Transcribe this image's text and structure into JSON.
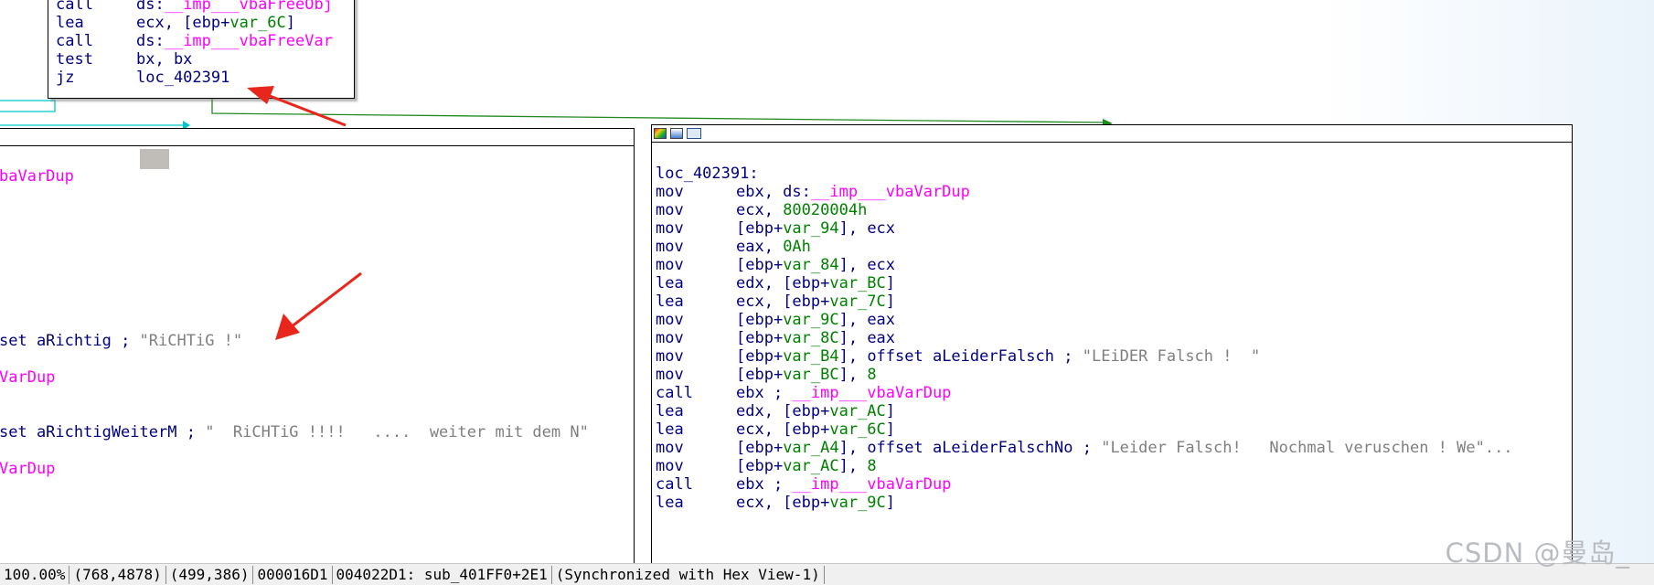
{
  "top_block": {
    "lines": [
      {
        "mnemonic": "call",
        "tokens": [
          {
            "t": "ds:",
            "c": "reg"
          },
          {
            "t": "__imp___vbaFreeObj",
            "c": "imp"
          }
        ]
      },
      {
        "mnemonic": "lea",
        "tokens": [
          {
            "t": "ecx, [ebp+",
            "c": "reg"
          },
          {
            "t": "var_6C",
            "c": "var"
          },
          {
            "t": "]",
            "c": "reg"
          }
        ]
      },
      {
        "mnemonic": "call",
        "tokens": [
          {
            "t": "ds:",
            "c": "reg"
          },
          {
            "t": "__imp___vbaFreeVar",
            "c": "imp"
          }
        ]
      },
      {
        "mnemonic": "test",
        "tokens": [
          {
            "t": "bx, bx",
            "c": "reg"
          }
        ]
      },
      {
        "mnemonic": "jz",
        "tokens": [
          {
            "t": "loc_402391",
            "c": "reg"
          }
        ]
      }
    ]
  },
  "left_block": {
    "lines": [
      {
        "row": 1,
        "tokens": [
          {
            "t": "baVarDup",
            "c": "imp"
          }
        ]
      },
      {
        "row": 10,
        "tokens": [
          {
            "t": "set aRichtig",
            "c": "reg"
          },
          {
            "t": " ; ",
            "c": "reg"
          },
          {
            "t": "\"RiCHTiG !\"",
            "c": "cmt"
          }
        ]
      },
      {
        "row": 12,
        "tokens": [
          {
            "t": "VarDup",
            "c": "imp"
          }
        ]
      },
      {
        "row": 15,
        "tokens": [
          {
            "t": "set aRichtigWeiterM",
            "c": "reg"
          },
          {
            "t": " ; ",
            "c": "reg"
          },
          {
            "t": "\"  RiCHTiG !!!!   ....  weiter mit dem N\"",
            "c": "cmt"
          }
        ]
      },
      {
        "row": 17,
        "tokens": [
          {
            "t": "VarDup",
            "c": "imp"
          }
        ]
      }
    ]
  },
  "right_block": {
    "label": "loc_402391:",
    "lines": [
      {
        "mnemonic": "mov",
        "tokens": [
          {
            "t": "ebx, ds:",
            "c": "reg"
          },
          {
            "t": "__imp___vbaVarDup",
            "c": "imp"
          }
        ]
      },
      {
        "mnemonic": "mov",
        "tokens": [
          {
            "t": "ecx, ",
            "c": "reg"
          },
          {
            "t": "80020004h",
            "c": "num"
          }
        ]
      },
      {
        "mnemonic": "mov",
        "tokens": [
          {
            "t": "[ebp+",
            "c": "reg"
          },
          {
            "t": "var_94",
            "c": "var"
          },
          {
            "t": "], ecx",
            "c": "reg"
          }
        ]
      },
      {
        "mnemonic": "mov",
        "tokens": [
          {
            "t": "eax, ",
            "c": "reg"
          },
          {
            "t": "0Ah",
            "c": "num"
          }
        ]
      },
      {
        "mnemonic": "mov",
        "tokens": [
          {
            "t": "[ebp+",
            "c": "reg"
          },
          {
            "t": "var_84",
            "c": "var"
          },
          {
            "t": "], ecx",
            "c": "reg"
          }
        ]
      },
      {
        "mnemonic": "lea",
        "tokens": [
          {
            "t": "edx, [ebp+",
            "c": "reg"
          },
          {
            "t": "var_BC",
            "c": "var"
          },
          {
            "t": "]",
            "c": "reg"
          }
        ]
      },
      {
        "mnemonic": "lea",
        "tokens": [
          {
            "t": "ecx, [ebp+",
            "c": "reg"
          },
          {
            "t": "var_7C",
            "c": "var"
          },
          {
            "t": "]",
            "c": "reg"
          }
        ]
      },
      {
        "mnemonic": "mov",
        "tokens": [
          {
            "t": "[ebp+",
            "c": "reg"
          },
          {
            "t": "var_9C",
            "c": "var"
          },
          {
            "t": "], eax",
            "c": "reg"
          }
        ]
      },
      {
        "mnemonic": "mov",
        "tokens": [
          {
            "t": "[ebp+",
            "c": "reg"
          },
          {
            "t": "var_8C",
            "c": "var"
          },
          {
            "t": "], eax",
            "c": "reg"
          }
        ]
      },
      {
        "mnemonic": "mov",
        "tokens": [
          {
            "t": "[ebp+",
            "c": "reg"
          },
          {
            "t": "var_B4",
            "c": "var"
          },
          {
            "t": "], offset aLeiderFalsch",
            "c": "reg"
          },
          {
            "t": " ; ",
            "c": "reg"
          },
          {
            "t": "\"LEiDER Falsch !  \"",
            "c": "cmt"
          }
        ]
      },
      {
        "mnemonic": "mov",
        "tokens": [
          {
            "t": "[ebp+",
            "c": "reg"
          },
          {
            "t": "var_BC",
            "c": "var"
          },
          {
            "t": "], ",
            "c": "reg"
          },
          {
            "t": "8",
            "c": "num"
          }
        ]
      },
      {
        "mnemonic": "call",
        "tokens": [
          {
            "t": "ebx ; ",
            "c": "reg"
          },
          {
            "t": "__imp___vbaVarDup",
            "c": "imp"
          }
        ]
      },
      {
        "mnemonic": "lea",
        "tokens": [
          {
            "t": "edx, [ebp+",
            "c": "reg"
          },
          {
            "t": "var_AC",
            "c": "var"
          },
          {
            "t": "]",
            "c": "reg"
          }
        ]
      },
      {
        "mnemonic": "lea",
        "tokens": [
          {
            "t": "ecx, [ebp+",
            "c": "reg"
          },
          {
            "t": "var_6C",
            "c": "var"
          },
          {
            "t": "]",
            "c": "reg"
          }
        ]
      },
      {
        "mnemonic": "mov",
        "tokens": [
          {
            "t": "[ebp+",
            "c": "reg"
          },
          {
            "t": "var_A4",
            "c": "var"
          },
          {
            "t": "], offset aLeiderFalschNo",
            "c": "reg"
          },
          {
            "t": " ; ",
            "c": "reg"
          },
          {
            "t": "\"Leider Falsch!   Nochmal veruschen ! We\"...",
            "c": "cmt"
          }
        ]
      },
      {
        "mnemonic": "mov",
        "tokens": [
          {
            "t": "[ebp+",
            "c": "reg"
          },
          {
            "t": "var_AC",
            "c": "var"
          },
          {
            "t": "], ",
            "c": "reg"
          },
          {
            "t": "8",
            "c": "num"
          }
        ]
      },
      {
        "mnemonic": "call",
        "tokens": [
          {
            "t": "ebx ; ",
            "c": "reg"
          },
          {
            "t": "__imp___vbaVarDup",
            "c": "imp"
          }
        ]
      },
      {
        "mnemonic": "lea",
        "tokens": [
          {
            "t": "ecx, [ebp+",
            "c": "reg"
          },
          {
            "t": "var_9C",
            "c": "var"
          },
          {
            "t": "]",
            "c": "reg"
          }
        ]
      }
    ]
  },
  "status_bar": {
    "zoom": "100.00%",
    "graph_coords": "(768,4878)",
    "mouse_coords": "(499,386)",
    "file_offset": "000016D1",
    "address": "004022D1: sub_401FF0+2E1",
    "sync": "(Synchronized with Hex View-1)"
  },
  "watermark": "CSDN @曼岛_",
  "colors": {
    "mnemonic": "#000080",
    "imported_name": "#ff00ff",
    "variable": "#008000",
    "comment": "#7f7f7f",
    "true_branch_edge": "#00c8c8",
    "jump_edge": "#1f8a1f",
    "annotation_arrow": "#e8261c"
  },
  "icons": [
    "graph-color-icon",
    "graph-palette-icon",
    "graph-overview-icon"
  ]
}
